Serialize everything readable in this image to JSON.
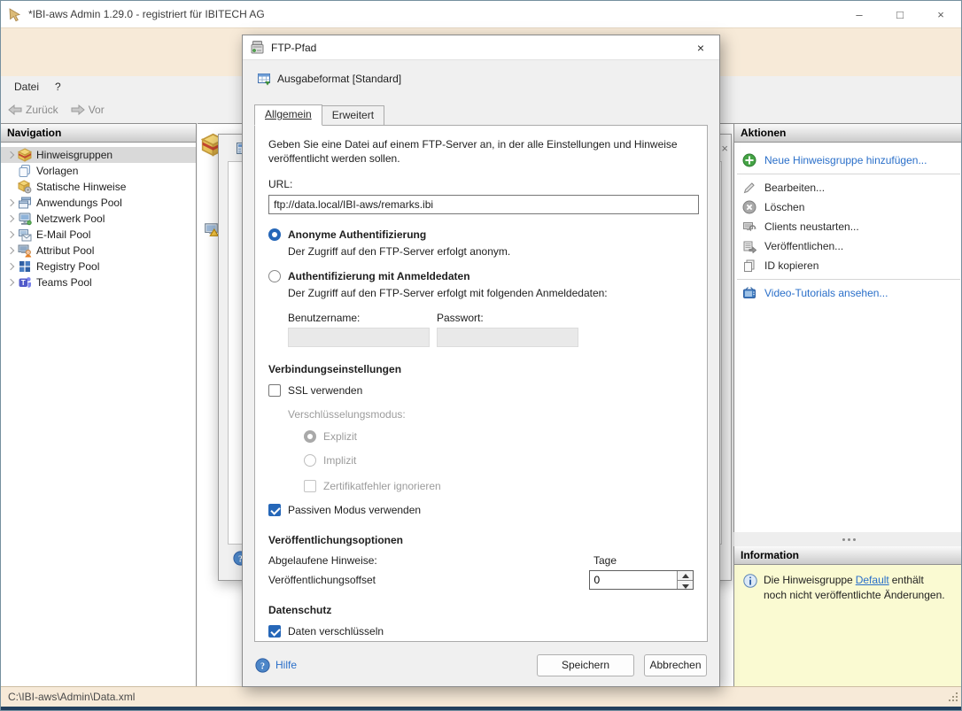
{
  "window": {
    "title": "*IBI-aws Admin 1.29.0 - registriert für IBITECH AG",
    "controls": {
      "minimize": "–",
      "maximize": "□",
      "close": "×"
    },
    "status_path": "C:\\IBI-aws\\Admin\\Data.xml"
  },
  "menu": {
    "file": "Datei",
    "help": "?"
  },
  "toolbar": {
    "back": "Zurück",
    "forward": "Vor"
  },
  "navigation": {
    "header": "Navigation",
    "items": [
      {
        "label": "Hinweisgruppen"
      },
      {
        "label": "Vorlagen"
      },
      {
        "label": "Statische Hinweise"
      },
      {
        "label": "Anwendungs Pool"
      },
      {
        "label": "Netzwerk Pool"
      },
      {
        "label": "E-Mail Pool"
      },
      {
        "label": "Attribut Pool"
      },
      {
        "label": "Registry Pool"
      },
      {
        "label": "Teams Pool"
      }
    ]
  },
  "actions": {
    "header": "Aktionen",
    "add": "Neue Hinweisgruppe hinzufügen...",
    "edit": "Bearbeiten...",
    "delete": "Löschen",
    "restart": "Clients neustarten...",
    "publish": "Veröffentlichen...",
    "copy_id": "ID kopieren",
    "videos": "Video-Tutorials ansehen..."
  },
  "information": {
    "header": "Information",
    "text_before": "Die Hinweisgruppe",
    "link": "Default",
    "text_after": "enthält noch nicht veröffentlichte Änderungen."
  },
  "background_dialog": {
    "close": "×"
  },
  "dialog": {
    "title": "FTP-Pfad",
    "close": "×",
    "subtitle": "Ausgabeformat [Standard]",
    "tabs": {
      "general": "Allgemein",
      "advanced": "Erweitert"
    },
    "description": "Geben Sie eine Datei auf einem FTP-Server an, in der alle Einstellungen und Hinweise veröffentlicht werden sollen.",
    "url_label": "URL:",
    "url_value": "ftp://data.local/IBI-aws/remarks.ibi",
    "auth": {
      "anonymous_label": "Anonyme Authentifizierung",
      "anonymous_desc": "Der Zugriff auf den FTP-Server erfolgt anonym.",
      "credentials_label": "Authentifizierung mit Anmeldedaten",
      "credentials_desc": "Der Zugriff auf den FTP-Server erfolgt mit folgenden Anmeldedaten:",
      "username_label": "Benutzername:",
      "password_label": "Passwort:"
    },
    "connection": {
      "heading": "Verbindungseinstellungen",
      "ssl_label": "SSL verwenden",
      "mode_label": "Verschlüsselungsmodus:",
      "explicit_label": "Explizit",
      "implicit_label": "Implizit",
      "cert_label": "Zertifikatfehler ignorieren",
      "passive_label": "Passiven Modus verwenden"
    },
    "publishing": {
      "heading": "Veröffentlichungsoptionen",
      "expired_label": "Abgelaufene Hinweise:",
      "days_label": "Tage",
      "offset_label": "Veröffentlichungsoffset",
      "offset_value": "0"
    },
    "privacy": {
      "heading": "Datenschutz",
      "encrypt_label": "Daten verschlüsseln"
    },
    "footer": {
      "help": "Hilfe",
      "save": "Speichern",
      "cancel": "Abbrechen"
    }
  },
  "colors": {
    "accent_link": "#2a6fc9",
    "control_blue": "#2667b8",
    "info_background": "#fafad2",
    "band_tan": "#f7ead8",
    "status_border": "#23405e"
  }
}
